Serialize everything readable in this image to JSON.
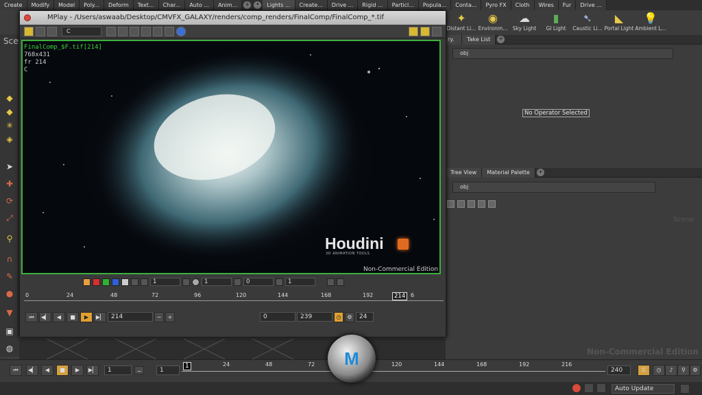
{
  "shelf": {
    "tabs": [
      "Create",
      "Modify",
      "Model",
      "Poly...",
      "Deform",
      "Text...",
      "Char...",
      "Auto ...",
      "Anim...",
      "Lights ...",
      "Create...",
      "Drive ...",
      "Rigid ...",
      "Particl...",
      "Popula...",
      "Conta...",
      "Pyro FX",
      "Cloth",
      "Wires",
      "Fur",
      "Drive ..."
    ],
    "active_tab": "Lights ...",
    "tools": [
      "Distant Li...",
      "Environm...",
      "Sky Light",
      "GI Light",
      "Caustic Li...",
      "Portal Light",
      "Ambient L..."
    ]
  },
  "mplay": {
    "title": "MPlay - /Users/aswaab/Desktop/CMVFX_GALAXY/renders/comp_renders/FinalComp/FinalComp_*.tif",
    "channel": "C",
    "image_info": {
      "filename": "FinalComp_$F.tif[214]",
      "resolution": "768x431",
      "frame": "fr 214",
      "plane": "C"
    },
    "watermark_logo": "Houdini",
    "watermark_sub": "3D ANIMATION TOOLS",
    "watermark_edition": "Non-Commercial Edition",
    "controls": {
      "gamma": "1",
      "exposure": "1",
      "offset": "0",
      "gain": "1"
    },
    "timeline_ticks": [
      "0",
      "24",
      "48",
      "72",
      "96",
      "120",
      "144",
      "168",
      "192",
      "6"
    ],
    "current_frame_marker": "214",
    "play": {
      "current_frame": "214",
      "range_start": "0",
      "range_end": "239",
      "fps": "24"
    }
  },
  "panels": {
    "top_tabs": [
      "Scene View",
      "Take List"
    ],
    "top_path": "obj",
    "no_operator": "No Operator Selected",
    "bottom_tabs": [
      "Tree View",
      "Material Palette"
    ],
    "bottom_path": "obj",
    "scene_label": "Scene",
    "scene_watermark": "Scene",
    "nce_watermark": "Non-Commercial Edition"
  },
  "main_timeline": {
    "start_marker": "1",
    "ticks": [
      "24",
      "48",
      "72",
      "120",
      "144",
      "168",
      "192",
      "216"
    ],
    "current_frame": "1",
    "step": "1",
    "end_frame": "240",
    "auto_update": "Auto Update"
  },
  "logo_text": "M"
}
